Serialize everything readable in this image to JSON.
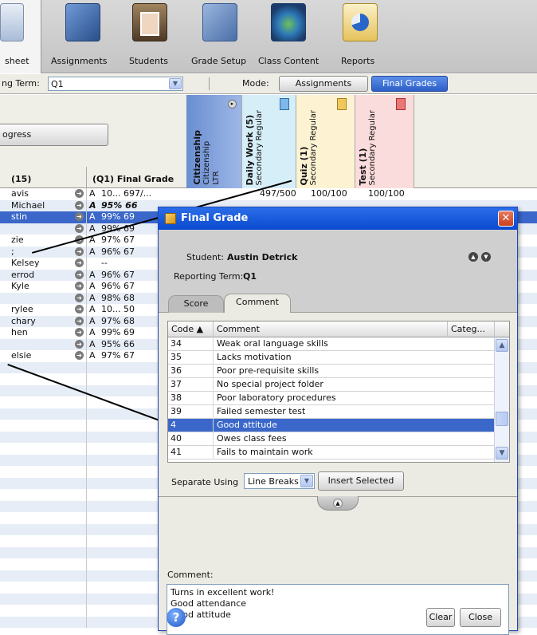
{
  "toolbar": {
    "items": [
      {
        "label": "sheet",
        "icon": "gradebook-icon"
      },
      {
        "label": "Assignments",
        "icon": "assignments-icon"
      },
      {
        "label": "Students",
        "icon": "students-icon"
      },
      {
        "label": "Grade Setup",
        "icon": "grade-setup-icon"
      },
      {
        "label": "Class Content",
        "icon": "class-content-icon"
      },
      {
        "label": "Reports",
        "icon": "reports-icon"
      }
    ]
  },
  "subbar": {
    "term_label": "ng Term:",
    "term_value": "Q1",
    "mode_label": "Mode:",
    "mode_assignments": "Assignments",
    "mode_final": "Final Grades"
  },
  "grid_header": {
    "progress_button": "ogress",
    "name_col": "(15)",
    "final_col": "(Q1) Final Grade",
    "citizenship": {
      "title": "Citizenship",
      "line2": "Citizenship",
      "line3": "LTR"
    },
    "daily_work": {
      "title": "Daily Work (5)",
      "line2": "Secondary Regular"
    },
    "quiz": {
      "title": "Quiz (1)",
      "line2": "Secondary Regular"
    },
    "test": {
      "title": "Test (1)",
      "line2": "Secondary Regular"
    }
  },
  "students": [
    {
      "name": "avis",
      "grade": "A",
      "pct": "10... 697/...",
      "daily": "497/500",
      "quiz": "100/100",
      "test": "100/100"
    },
    {
      "name": "Michael",
      "grade": "A",
      "pct": "95% 66",
      "bold": true
    },
    {
      "name": "stin",
      "grade": "A",
      "pct": "99% 69",
      "selected": true
    },
    {
      "name": "",
      "grade": "A",
      "pct": "99% 69"
    },
    {
      "name": "zie",
      "grade": "A",
      "pct": "97% 67"
    },
    {
      "name": ";",
      "grade": "A",
      "pct": "96% 67"
    },
    {
      "name": "Kelsey",
      "grade": "",
      "pct": "--"
    },
    {
      "name": "errod",
      "grade": "A",
      "pct": "96% 67"
    },
    {
      "name": "Kyle",
      "grade": "A",
      "pct": "96% 67"
    },
    {
      "name": "",
      "grade": "A",
      "pct": "98% 68"
    },
    {
      "name": "rylee",
      "grade": "A",
      "pct": "10... 50"
    },
    {
      "name": "chary",
      "grade": "A",
      "pct": "97% 68"
    },
    {
      "name": "hen",
      "grade": "A",
      "pct": "99% 69"
    },
    {
      "name": "",
      "grade": "A",
      "pct": "95% 66"
    },
    {
      "name": "elsie",
      "grade": "A",
      "pct": "97% 67"
    }
  ],
  "dialog": {
    "title": "Final Grade",
    "student_label": "Student:",
    "student_name": "Austin Detrick",
    "term_label": "Reporting Term:",
    "term_value": "Q1",
    "tab_score": "Score",
    "tab_comment": "Comment",
    "table_headers": {
      "code": "Code ▲",
      "comment": "Comment",
      "category": "Categ..."
    },
    "comments": [
      {
        "code": "34",
        "text": "Weak oral language skills"
      },
      {
        "code": "35",
        "text": "Lacks motivation"
      },
      {
        "code": "36",
        "text": "Poor pre-requisite skills"
      },
      {
        "code": "37",
        "text": "No special project folder"
      },
      {
        "code": "38",
        "text": "Poor laboratory procedures"
      },
      {
        "code": "39",
        "text": "Failed semester test"
      },
      {
        "code": "4",
        "text": "Good attitude",
        "selected": true
      },
      {
        "code": "40",
        "text": "Owes class fees"
      },
      {
        "code": "41",
        "text": "Fails to maintain work"
      }
    ],
    "separate_label": "Separate Using",
    "separate_value": "Line Breaks",
    "insert_button": "Insert Selected",
    "comment_label": "Comment:",
    "comment_text": "Turns in excellent work!\nGood attendance\nGood attitude",
    "clear_button": "Clear",
    "close_button": "Close",
    "help_icon": "help-icon"
  },
  "colors": {
    "selected_row": "#3a67c9",
    "title_bar": "#0a49d0",
    "mode_active": "#3a6fd4",
    "citizenship_col": "#6b8fd3",
    "daily_col": "#d6eef8",
    "quiz_col": "#fdf3d3",
    "test_col": "#fbdcdc"
  }
}
